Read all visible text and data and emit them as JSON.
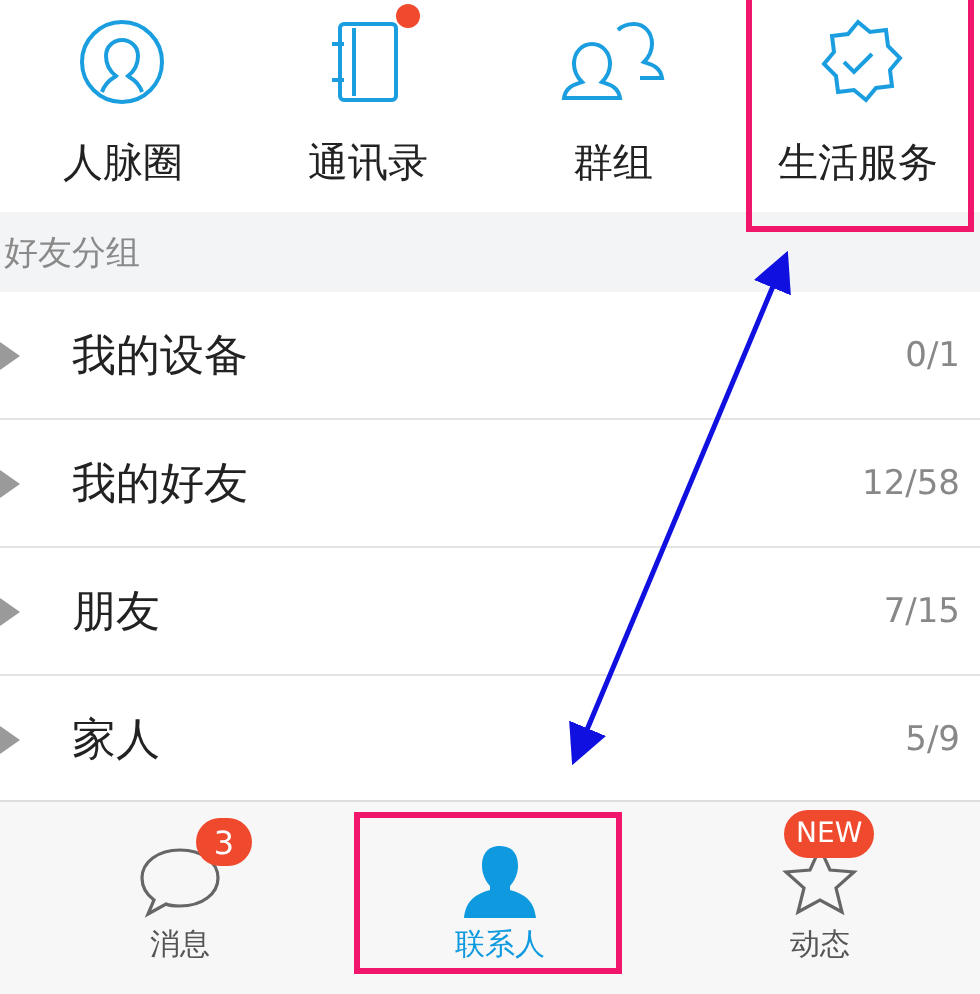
{
  "shortcuts": [
    {
      "label": "人脉圈",
      "kind": "person-circle",
      "dot": false
    },
    {
      "label": "通讯录",
      "kind": "notebook",
      "dot": true
    },
    {
      "label": "群组",
      "kind": "people",
      "dot": false
    },
    {
      "label": "生活服务",
      "kind": "badge-check",
      "dot": false
    }
  ],
  "section": {
    "title": "好友分组"
  },
  "groups": [
    {
      "name": "我的设备",
      "count": "0/1",
      "expanded": false
    },
    {
      "name": "我的好友",
      "count": "12/58",
      "expanded": false
    },
    {
      "name": "朋友",
      "count": "7/15",
      "expanded": false
    },
    {
      "name": "家人",
      "count": "5/9",
      "expanded": false
    }
  ],
  "tabs": [
    {
      "label": "消息",
      "kind": "chat",
      "selected": false,
      "badge": "3"
    },
    {
      "label": "联系人",
      "kind": "person",
      "selected": true
    },
    {
      "label": "动态",
      "kind": "star",
      "selected": false,
      "badge": "NEW"
    }
  ]
}
